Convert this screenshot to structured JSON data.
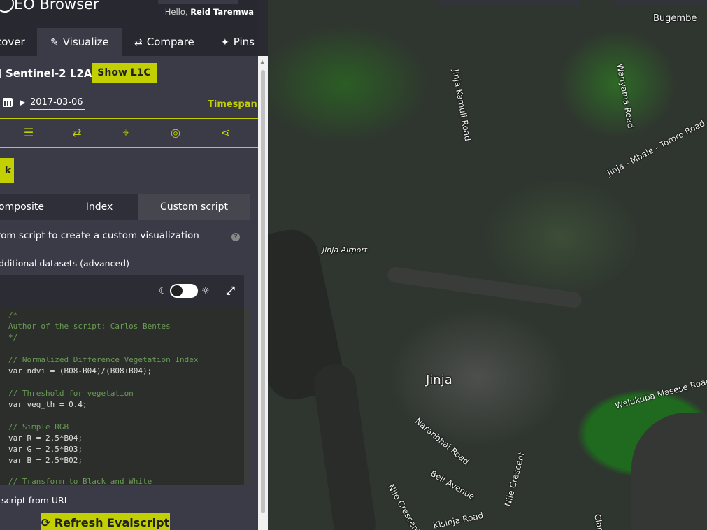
{
  "app": {
    "title": "EO Browser"
  },
  "user": {
    "greeting": "Hello,",
    "name": "Reid Taremwa"
  },
  "tabs": [
    {
      "label": "cover",
      "icon": "search-icon"
    },
    {
      "label": "Visualize",
      "icon": "paintbrush-icon",
      "active": true
    },
    {
      "label": "Compare",
      "icon": "swap-icon"
    },
    {
      "label": "Pins",
      "icon": "pin-icon"
    }
  ],
  "dataset": {
    "name": "Sentinel-2 L2A",
    "toggle_label": "Show L1C"
  },
  "date": {
    "value": "2017-03-06",
    "timespan_label": "Timespan"
  },
  "toolbar_icons": [
    "sliders-icon",
    "swap-icon",
    "crosshair-icon",
    "eye-slash-icon",
    "share-icon"
  ],
  "back_button": {
    "label": "k"
  },
  "subtabs": [
    {
      "label": "omposite"
    },
    {
      "label": "Index"
    },
    {
      "label": "Custom script",
      "active": true
    }
  ],
  "custom_script": {
    "description": "tom script to create a custom visualization",
    "help": "?",
    "additional_datasets": "dditional datasets (advanced)",
    "code_lines": [
      {
        "text": "/*",
        "kind": "com"
      },
      {
        "text": "Author of the script: Carlos Bentes",
        "kind": "com"
      },
      {
        "text": "*/",
        "kind": "com"
      },
      {
        "text": "",
        "kind": "txt"
      },
      {
        "text": "// Normalized Difference Vegetation Index",
        "kind": "com"
      },
      {
        "text": "var ndvi = (B08-B04)/(B08+B04);",
        "kind": "txt"
      },
      {
        "text": "",
        "kind": "txt"
      },
      {
        "text": "// Threshold for vegetation",
        "kind": "com"
      },
      {
        "text": "var veg_th = 0.4;",
        "kind": "txt"
      },
      {
        "text": "",
        "kind": "txt"
      },
      {
        "text": "// Simple RGB",
        "kind": "com"
      },
      {
        "text": "var R = 2.5*B04;",
        "kind": "txt"
      },
      {
        "text": "var G = 2.5*B03;",
        "kind": "txt"
      },
      {
        "text": "var B = 2.5*B02;",
        "kind": "txt"
      },
      {
        "text": "",
        "kind": "txt"
      },
      {
        "text": "// Transform to Black and White",
        "kind": "com"
      }
    ],
    "url_label": "script from URL",
    "refresh_label": "Refresh Evalscript"
  },
  "map": {
    "labels": {
      "bugembe": "Bugembe",
      "jinja_kamuli": "Jinja Kamuli Road",
      "wanyama": "Wanyama Road",
      "mbale_tororo": "Jinja - Mbale - Tororo Road",
      "airport": "Jinja Airport",
      "jinja": "Jinja",
      "walukuba": "Walukuba Masese Road",
      "naranbhai": "Naranbhai Road",
      "bell": "Bell Avenue",
      "nile_crescent": "Nile Crescent",
      "nile_crescent2": "Nile Crescent",
      "kisinja": "Kisinja Road",
      "clar": "Clar"
    }
  },
  "colors": {
    "accent": "#c2cf00",
    "panel_bg": "#3b3b48",
    "topbar_bg": "#282830"
  }
}
